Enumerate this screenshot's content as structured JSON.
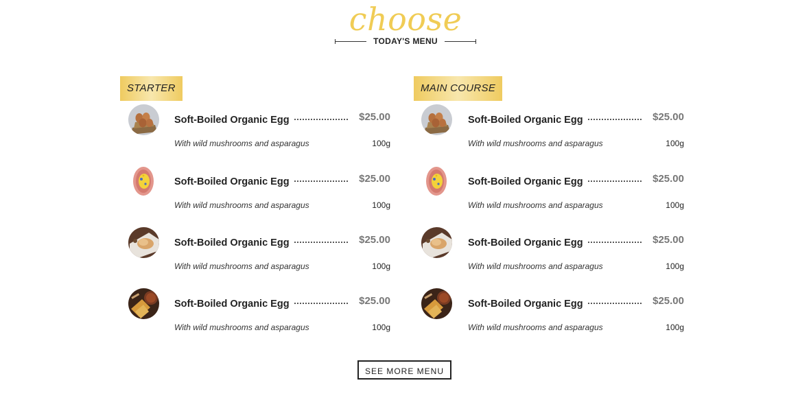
{
  "header": {
    "script_title": "choose",
    "subtitle": "TODAY'S MENU"
  },
  "columns": [
    {
      "category": "STARTER",
      "items": [
        {
          "name": "Soft-Boiled Organic Egg",
          "price": "$25.00",
          "description": "With wild mushrooms and asparagus",
          "weight": "100g",
          "image": "eggs-basket-image"
        },
        {
          "name": "Soft-Boiled Organic Egg",
          "price": "$25.00",
          "description": "With wild mushrooms and asparagus",
          "weight": "100g",
          "image": "omelette-plate-image"
        },
        {
          "name": "Soft-Boiled Organic Egg",
          "price": "$25.00",
          "description": "With wild mushrooms and asparagus",
          "weight": "100g",
          "image": "pastry-plate-image"
        },
        {
          "name": "Soft-Boiled Organic Egg",
          "price": "$25.00",
          "description": "With wild mushrooms and asparagus",
          "weight": "100g",
          "image": "toast-tea-image"
        }
      ]
    },
    {
      "category": "MAIN COURSE",
      "items": [
        {
          "name": "Soft-Boiled Organic Egg",
          "price": "$25.00",
          "description": "With wild mushrooms and asparagus",
          "weight": "100g",
          "image": "eggs-basket-image"
        },
        {
          "name": "Soft-Boiled Organic Egg",
          "price": "$25.00",
          "description": "With wild mushrooms and asparagus",
          "weight": "100g",
          "image": "omelette-plate-image"
        },
        {
          "name": "Soft-Boiled Organic Egg",
          "price": "$25.00",
          "description": "With wild mushrooms and asparagus",
          "weight": "100g",
          "image": "pastry-plate-image"
        },
        {
          "name": "Soft-Boiled Organic Egg",
          "price": "$25.00",
          "description": "With wild mushrooms and asparagus",
          "weight": "100g",
          "image": "toast-tea-image"
        }
      ]
    }
  ],
  "see_more_label": "SEE MORE MENU",
  "colors": {
    "accent_gold": "#f0cc55",
    "price_gray": "#777777",
    "text_dark": "#222222"
  }
}
